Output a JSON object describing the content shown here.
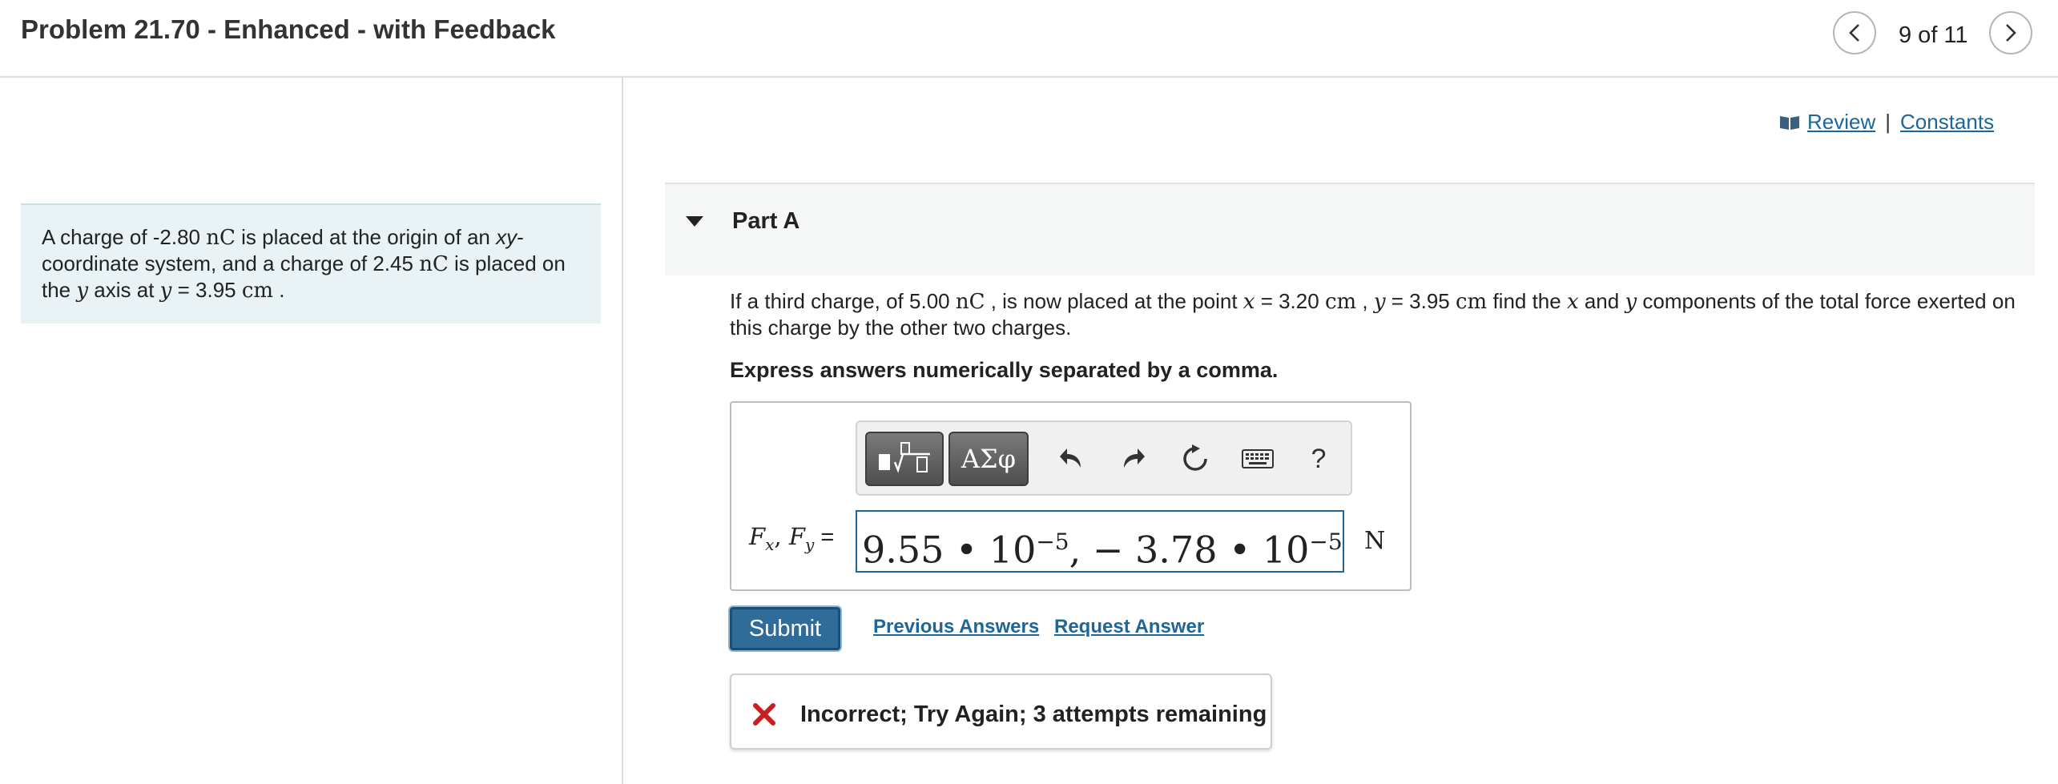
{
  "header": {
    "title": "Problem 21.70 - Enhanced - with Feedback",
    "nav_count": "9 of 11"
  },
  "context": {
    "t1": "A charge of -2.80 ",
    "unit1": "nC",
    "t2": " is placed at the origin of an ",
    "xy": "xy",
    "t3": "-coordinate system, and a charge of 2.45 ",
    "unit2": "nC",
    "t4": " is placed on the ",
    "yvar": "y",
    "t5": " axis at ",
    "yvar2": "y",
    "t6": " = 3.95 ",
    "unit3": "cm",
    "t7": " ."
  },
  "links": {
    "review": "Review",
    "separator": "|",
    "constants": "Constants"
  },
  "part": {
    "label": "Part A"
  },
  "question": {
    "q1": "If a third charge, of 5.00 ",
    "qunit1": "nC",
    "q2": " , is now placed at the point ",
    "qx": "x",
    "q3": " = 3.20 ",
    "qunit2": "cm",
    "q4": " , ",
    "qy": "y",
    "q5": " = 3.95 ",
    "qunit3": "cm",
    "q6": " find the ",
    "qx2": "x",
    "q7": " and ",
    "qy2": "y",
    "q8": " components of the total force exerted on this charge by the other two charges."
  },
  "instruction": "Express answers numerically separated by a comma.",
  "toolbar": {
    "symbols_label": "ΑΣφ",
    "help_label": "?"
  },
  "answer": {
    "label_F": "F",
    "label_sub_x": "x",
    "label_comma": ", ",
    "label_F2": "F",
    "label_sub_y": "y",
    "label_eq": " =",
    "mant1": "9.55 • 10",
    "exp1": "−5",
    "middle": ", − 3.78 • 10",
    "exp2": "−5",
    "unit": "N"
  },
  "actions": {
    "submit": "Submit",
    "previous_answers": "Previous Answers",
    "request_answer": "Request Answer"
  },
  "feedback": {
    "message": "Incorrect; Try Again; 3 attempts remaining",
    "color": "#c8201e"
  }
}
